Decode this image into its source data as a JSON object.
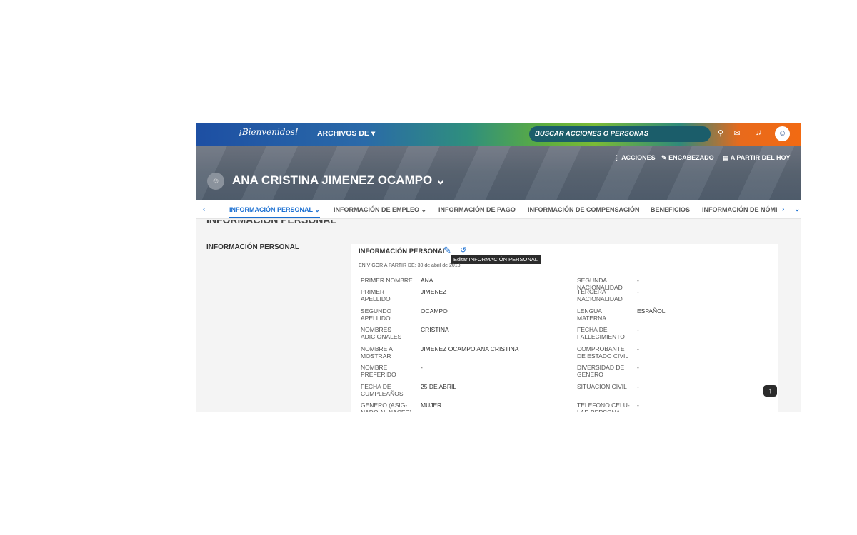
{
  "topbar": {
    "logo": "¡Bienvenidos!",
    "menu_label": "ARCHIVOS DE",
    "search_placeholder": "BUSCAR ACCIONES O PERSONAS"
  },
  "header": {
    "actions_label": "ACCIONES",
    "encabezado_label": "ENCABEZADO",
    "a_partir_label": "A PARTIR DEL HOY",
    "person_name": "ANA CRISTINA JIMENEZ OCAMPO"
  },
  "tabs": [
    {
      "label": "INFORMACIÓN PERSONAL"
    },
    {
      "label": "INFORMACIÓN DE EMPLEO"
    },
    {
      "label": "INFORMACIÓN DE PAGO"
    },
    {
      "label": "INFORMACIÓN DE COMPENSACIÓN"
    },
    {
      "label": "BENEFICIOS"
    },
    {
      "label": "INFORMACIÓN DE NÓMI"
    }
  ],
  "section": {
    "title": "INFORMACIÓN PERSONAL",
    "side_label": "INFORMACIÓN PERSONAL",
    "card_title": "INFORMACIÓN PERSONAL",
    "tooltip": "Editar INFORMACIÓN PERSONAL",
    "vigor": "EN VIGOR A PARTIR DE: 30 de abril de 2018"
  },
  "left_fields": [
    {
      "label": "PRIMER NOMBRE",
      "value": "ANA"
    },
    {
      "label": "PRIMER\nAPELLIDO",
      "value": "JIMENEZ"
    },
    {
      "label": "SEGUNDO\nAPELLIDO",
      "value": "OCAMPO"
    },
    {
      "label": "NOMBRES\nADICIONALES",
      "value": "CRISTINA"
    },
    {
      "label": "NOMBRE A\nMOSTRAR",
      "value": "JIMENEZ OCAMPO ANA CRISTINA"
    },
    {
      "label": "NOMBRE\nPREFERIDO",
      "value": "-"
    },
    {
      "label": "FECHA DE\nCUMPLEAÑOS",
      "value": "25 DE ABRIL"
    },
    {
      "label": "GENERO (ASIG-\nNADO AL NACER)",
      "value": "MUJER"
    }
  ],
  "right_fields": [
    {
      "label": "SEGUNDA\nNACIONALIDAD",
      "value": "-"
    },
    {
      "label": "TERCERA\nNACIONALIDAD",
      "value": "-"
    },
    {
      "label": "LENGUA\nMATERNA",
      "value": "ESPAÑOL"
    },
    {
      "label": "FECHA DE\nFALLECIMIENTO",
      "value": "-"
    },
    {
      "label": "COMPROBANTE\nDE ESTADO CIVIL",
      "value": "-"
    },
    {
      "label": "DIVERSIDAD DE\nGENERO",
      "value": "-"
    },
    {
      "label": "SITUACION CIVIL",
      "value": "-"
    },
    {
      "label": "TELEFONO CELU-\nLAR PERSONAL",
      "value": "-"
    }
  ],
  "icons": {
    "search": "search-icon",
    "chat": "chat-icon",
    "bell": "bell-icon",
    "user": "user-icon",
    "edit": "edit-icon",
    "history": "history-icon",
    "pencil": "pencil-icon",
    "calendar": "calendar-icon"
  }
}
